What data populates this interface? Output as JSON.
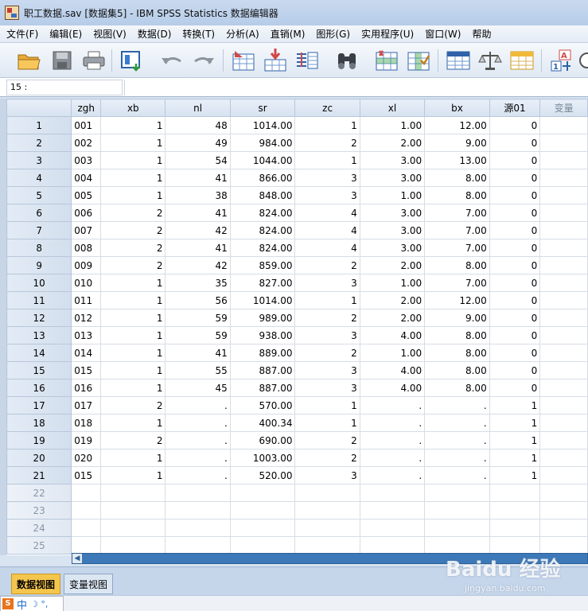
{
  "window": {
    "title": "职工数据.sav [数据集5] - IBM SPSS Statistics 数据编辑器"
  },
  "menu": [
    "文件(F)",
    "编辑(E)",
    "视图(V)",
    "数据(D)",
    "转换(T)",
    "分析(A)",
    "直销(M)",
    "图形(G)",
    "实用程序(U)",
    "窗口(W)",
    "帮助"
  ],
  "toolbar": [
    {
      "name": "open-folder-icon"
    },
    {
      "name": "save-icon"
    },
    {
      "name": "print-icon"
    },
    {
      "name": "dialog-recall-icon"
    },
    {
      "name": "undo-icon"
    },
    {
      "name": "redo-icon"
    },
    {
      "name": "goto-case-icon"
    },
    {
      "name": "goto-variable-icon"
    },
    {
      "name": "variables-icon"
    },
    {
      "name": "find-icon"
    },
    {
      "name": "insert-cases-icon"
    },
    {
      "name": "insert-variable-icon"
    },
    {
      "name": "split-file-icon"
    },
    {
      "name": "weight-cases-icon"
    },
    {
      "name": "select-cases-icon"
    },
    {
      "name": "value-labels-icon"
    },
    {
      "name": "use-sets-icon"
    }
  ],
  "cell_ref": {
    "label": "15 :",
    "value": ""
  },
  "grid": {
    "columns": [
      "zgh",
      "xb",
      "nl",
      "sr",
      "zc",
      "xl",
      "bx",
      "源01",
      "变量"
    ],
    "rows": [
      [
        "1",
        "001",
        "1",
        "48",
        "1014.00",
        "1",
        "1.00",
        "12.00",
        "0"
      ],
      [
        "2",
        "002",
        "1",
        "49",
        "984.00",
        "2",
        "2.00",
        "9.00",
        "0"
      ],
      [
        "3",
        "003",
        "1",
        "54",
        "1044.00",
        "1",
        "3.00",
        "13.00",
        "0"
      ],
      [
        "4",
        "004",
        "1",
        "41",
        "866.00",
        "3",
        "3.00",
        "8.00",
        "0"
      ],
      [
        "5",
        "005",
        "1",
        "38",
        "848.00",
        "3",
        "1.00",
        "8.00",
        "0"
      ],
      [
        "6",
        "006",
        "2",
        "41",
        "824.00",
        "4",
        "3.00",
        "7.00",
        "0"
      ],
      [
        "7",
        "007",
        "2",
        "42",
        "824.00",
        "4",
        "3.00",
        "7.00",
        "0"
      ],
      [
        "8",
        "008",
        "2",
        "41",
        "824.00",
        "4",
        "3.00",
        "7.00",
        "0"
      ],
      [
        "9",
        "009",
        "2",
        "42",
        "859.00",
        "2",
        "2.00",
        "8.00",
        "0"
      ],
      [
        "10",
        "010",
        "1",
        "35",
        "827.00",
        "3",
        "1.00",
        "7.00",
        "0"
      ],
      [
        "11",
        "011",
        "1",
        "56",
        "1014.00",
        "1",
        "2.00",
        "12.00",
        "0"
      ],
      [
        "12",
        "012",
        "1",
        "59",
        "989.00",
        "2",
        "2.00",
        "9.00",
        "0"
      ],
      [
        "13",
        "013",
        "1",
        "59",
        "938.00",
        "3",
        "4.00",
        "8.00",
        "0"
      ],
      [
        "14",
        "014",
        "1",
        "41",
        "889.00",
        "2",
        "1.00",
        "8.00",
        "0"
      ],
      [
        "15",
        "015",
        "1",
        "55",
        "887.00",
        "3",
        "4.00",
        "8.00",
        "0"
      ],
      [
        "16",
        "016",
        "1",
        "45",
        "887.00",
        "3",
        "4.00",
        "8.00",
        "0"
      ],
      [
        "17",
        "017",
        "2",
        ".",
        "570.00",
        "1",
        ".",
        ".",
        "1"
      ],
      [
        "18",
        "018",
        "1",
        ".",
        "400.34",
        "1",
        ".",
        ".",
        "1"
      ],
      [
        "19",
        "019",
        "2",
        ".",
        "690.00",
        "2",
        ".",
        ".",
        "1"
      ],
      [
        "20",
        "020",
        "1",
        ".",
        "1003.00",
        "2",
        ".",
        ".",
        "1"
      ],
      [
        "21",
        "015",
        "1",
        ".",
        "520.00",
        "3",
        ".",
        ".",
        "1"
      ]
    ],
    "empty_rows": [
      "22",
      "23",
      "24",
      "25"
    ]
  },
  "tabs": {
    "data_view": "数据视图",
    "variable_view": "变量视图"
  },
  "ime": {
    "logo": "S",
    "mode": "中",
    "symbols": "☽ °,"
  },
  "watermark": {
    "main": "Baidu 经验",
    "sub": "jingyan.baidu.com"
  },
  "colors": {
    "active_tab": "#f5c64d",
    "header_bg": "#d6e2f0",
    "scrollbar": "#3d78b8"
  }
}
